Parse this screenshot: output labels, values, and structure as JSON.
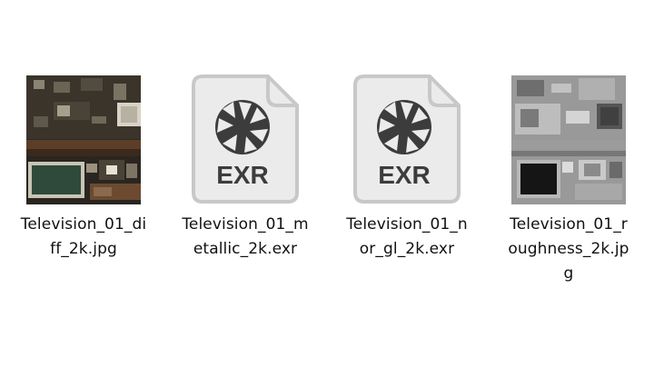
{
  "files": [
    {
      "name": "Television_01_diff_2k.jpg",
      "name_lines": [
        "Television_01_di",
        "ff_2k.jpg",
        ""
      ],
      "thumb_type": "image-thumbnail",
      "icon": "texture-diffuse-thumbnail"
    },
    {
      "name": "Television_01_metallic_2k.exr",
      "name_lines": [
        "Television_01_m",
        "etallic_2k.exr",
        ""
      ],
      "thumb_type": "file-icon",
      "icon": "exr-file-icon",
      "icon_label": "EXR"
    },
    {
      "name": "Television_01_nor_gl_2k.exr",
      "name_lines": [
        "Television_01_n",
        "or_gl_2k.exr",
        ""
      ],
      "thumb_type": "file-icon",
      "icon": "exr-file-icon",
      "icon_label": "EXR"
    },
    {
      "name": "Television_01_roughness_2k.jpg",
      "name_lines": [
        "Television_01_r",
        "oughness_2k.jp",
        "g"
      ],
      "thumb_type": "image-thumbnail",
      "icon": "texture-roughness-thumbnail"
    }
  ],
  "colors": {
    "text": "#111111",
    "icon_fill": "#ebebeb",
    "icon_border": "#c8c8c8",
    "icon_glyph": "#3c3c3c"
  }
}
